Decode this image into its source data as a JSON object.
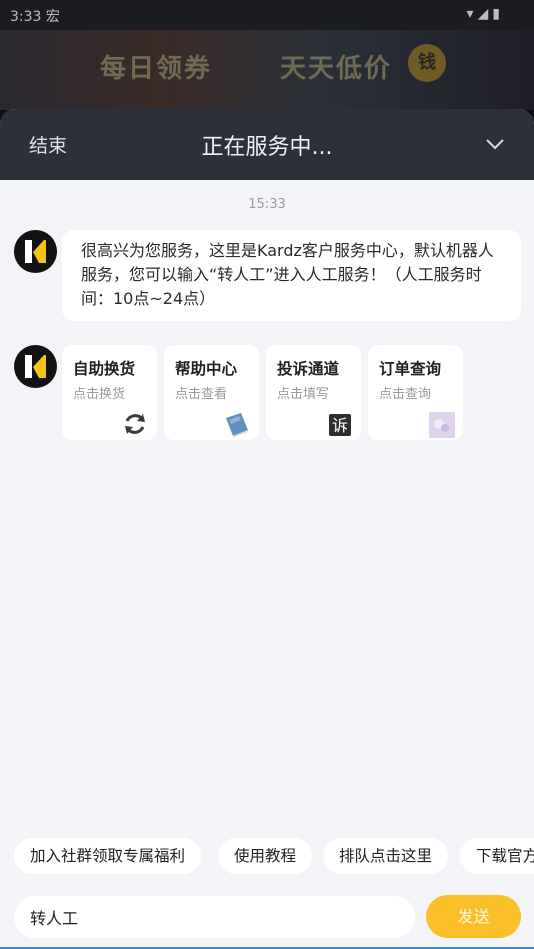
{
  "status_bar": {
    "time": "3:33",
    "carrier": "宏",
    "icons": [
      "wifi-icon",
      "signal-icon",
      "battery-icon"
    ]
  },
  "banner": {
    "text_left": "每日领券",
    "text_right": "天天低价",
    "badge": "钱"
  },
  "header": {
    "end_label": "结束",
    "title": "正在服务中...",
    "collapse_icon": "chevron-down-icon"
  },
  "chat": {
    "timestamp": "15:33",
    "bot_message": "很高兴为您服务，这里是Kardz客户服务中心，默认机器人服务，您可以输入“转人工”进入人工服务！（人工服务时间：10点~24点）",
    "cards": [
      {
        "title": "自助换货",
        "subtitle": "点击换货",
        "icon": "refresh-icon"
      },
      {
        "title": "帮助中心",
        "subtitle": "点击查看",
        "icon": "book-icon"
      },
      {
        "title": "投诉通道",
        "subtitle": "点击填写",
        "icon": "complaint-icon",
        "icon_char": "诉"
      },
      {
        "title": "订单查询",
        "subtitle": "点击查询",
        "icon": "order-icon"
      }
    ]
  },
  "quick_replies": [
    "加入社群领取专属福利",
    "使用教程",
    "排队点击这里",
    "下载官方"
  ],
  "composer": {
    "input_value": "转人工",
    "send_label": "发送"
  },
  "colors": {
    "header_bg": "#2d2f3b",
    "accent": "#fbbf2a",
    "page_bg": "#f3f4f8"
  }
}
